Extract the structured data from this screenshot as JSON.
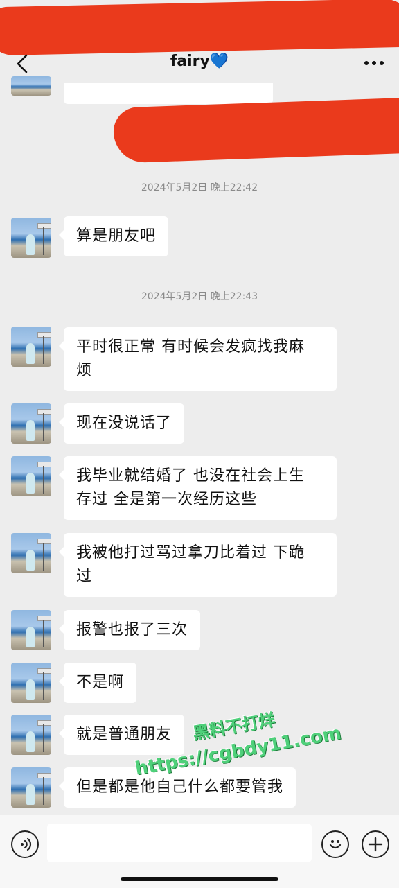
{
  "header": {
    "title": "fairy💙"
  },
  "messages": [
    {
      "type": "time",
      "text": "2024年5月2日 晚上22:42"
    },
    {
      "type": "received",
      "lines": [
        "算是朋友吧"
      ]
    },
    {
      "type": "time",
      "text": "2024年5月2日 晚上22:43"
    },
    {
      "type": "received",
      "lines": [
        "平时很正常 有时候会发疯找我麻",
        "烦"
      ]
    },
    {
      "type": "received",
      "lines": [
        "现在没说话了"
      ]
    },
    {
      "type": "received",
      "lines": [
        "我毕业就结婚了 也没在社会上生",
        "存过 全是第一次经历这些"
      ]
    },
    {
      "type": "received",
      "lines": [
        "我被他打过骂过拿刀比着过 下跪",
        "过"
      ]
    },
    {
      "type": "received",
      "lines": [
        "报警也报了三次"
      ]
    },
    {
      "type": "received",
      "lines": [
        "不是啊"
      ]
    },
    {
      "type": "received",
      "lines": [
        "就是普通朋友"
      ]
    },
    {
      "type": "received",
      "lines": [
        "但是都是他自己什么都要管我"
      ]
    }
  ],
  "input": {
    "value": "",
    "placeholder": ""
  },
  "watermark": {
    "line1": "黑料不打烊",
    "line2": "https://cgbdy11.com"
  },
  "colors": {
    "background": "#ededed",
    "bubble": "#ffffff",
    "redaction": "#ea3a1c",
    "watermark": "#4fd07a"
  }
}
